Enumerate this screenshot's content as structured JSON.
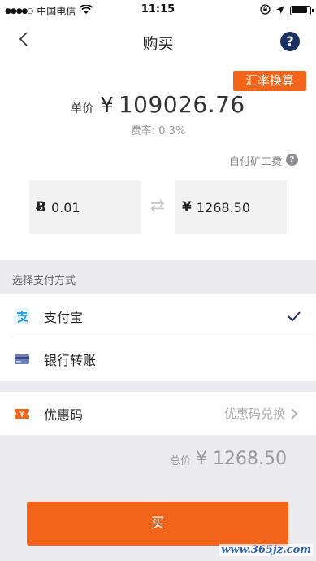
{
  "status_bar": {
    "carrier": "中国电信",
    "time": "11:15"
  },
  "nav": {
    "title": "购买"
  },
  "rate_button_label": "汇率换算",
  "price": {
    "label": "单价",
    "currency_symbol": "¥",
    "value": "109026.76",
    "fee_rate": "费率: 0.3%"
  },
  "miner_fee_label": "自付矿工费",
  "amounts": {
    "btc_symbol": "Ƀ",
    "btc_value": "0.01",
    "cny_symbol": "¥",
    "cny_value": "1268.50"
  },
  "payment": {
    "section_label": "选择支付方式",
    "options": [
      {
        "label": "支付宝",
        "selected": true
      },
      {
        "label": "银行转账",
        "selected": false
      }
    ]
  },
  "coupon": {
    "label": "优惠码",
    "action": "优惠码兑换"
  },
  "total": {
    "label": "总价",
    "value": "¥ 1268.50"
  },
  "buy_button_label": "买",
  "watermark": "www.365jz.com",
  "colors": {
    "accent": "#f26419",
    "navy": "#1b2f63",
    "alipay": "#1e9bde",
    "section_bg": "#ebebf0"
  }
}
